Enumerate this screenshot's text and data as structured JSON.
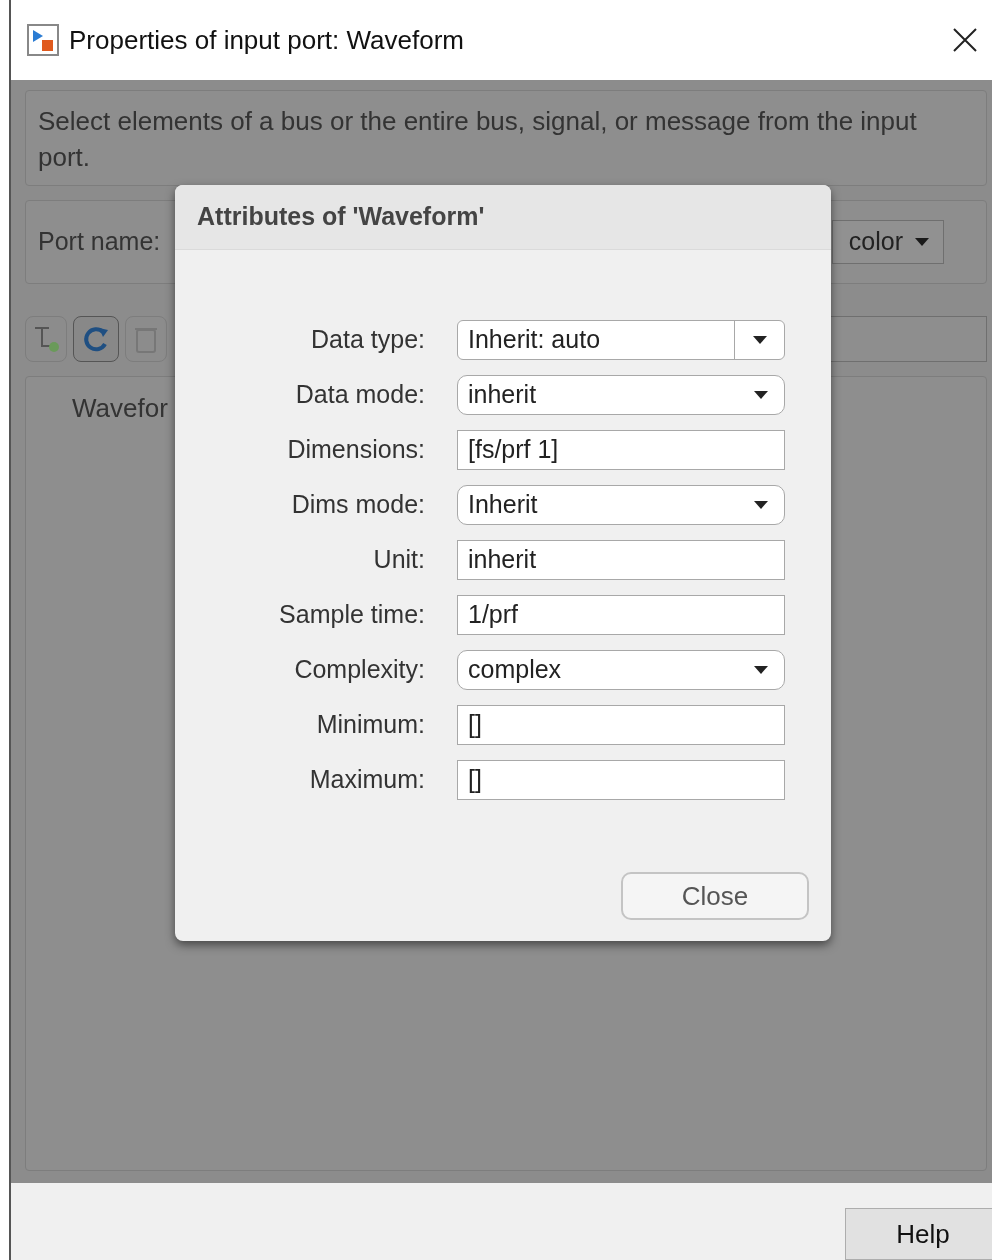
{
  "window": {
    "title": "Properties of input port: Waveform"
  },
  "description": "Select elements of a bus or the entire bus, signal, or message from the input port.",
  "port_name": {
    "label": "Port name:"
  },
  "color_dropdown": {
    "value": "color"
  },
  "tree": {
    "items": [
      {
        "label": "Wavefor",
        "selected": false
      }
    ]
  },
  "dialog": {
    "title": "Attributes of 'Waveform'",
    "fields": [
      {
        "label": "Data type:",
        "kind": "combo",
        "value": "Inherit: auto"
      },
      {
        "label": "Data mode:",
        "kind": "dropdown",
        "value": "inherit"
      },
      {
        "label": "Dimensions:",
        "kind": "text",
        "value": "[fs/prf 1]"
      },
      {
        "label": "Dims mode:",
        "kind": "dropdown",
        "value": "Inherit"
      },
      {
        "label": "Unit:",
        "kind": "text",
        "value": "inherit"
      },
      {
        "label": "Sample time:",
        "kind": "text",
        "value": "1/prf"
      },
      {
        "label": "Complexity:",
        "kind": "dropdown",
        "value": "complex"
      },
      {
        "label": "Minimum:",
        "kind": "text",
        "value": "[]"
      },
      {
        "label": "Maximum:",
        "kind": "text",
        "value": "[]"
      }
    ],
    "close_button": "Close"
  },
  "help_button": "Help"
}
